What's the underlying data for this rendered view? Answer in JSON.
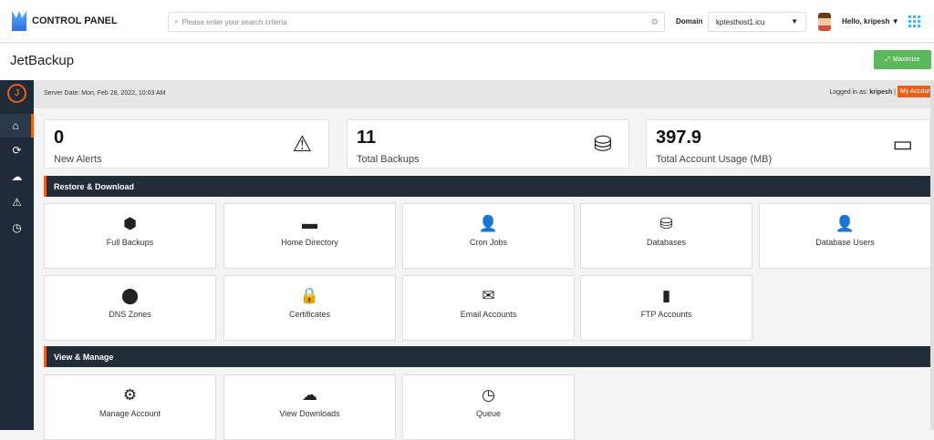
{
  "header": {
    "brand": "CONTROL PANEL",
    "search_placeholder": "Please enter your search criteria",
    "domain_label": "Domain",
    "domain_value": "kptesthost1.icu",
    "greeting": "Hello, kripesh"
  },
  "page": {
    "title": "JetBackup",
    "maximize_label": "Maximize"
  },
  "serverbar": {
    "server_date": "Server Date: Mon, Feb 28, 2022, 10:03 AM",
    "logged_in_prefix": "Logged in as:",
    "user": "kripesh",
    "my_account": "My Account"
  },
  "sidebar": {
    "items": [
      {
        "icon": "home-icon"
      },
      {
        "icon": "refresh-icon"
      },
      {
        "icon": "cloud-download-icon"
      },
      {
        "icon": "warning-icon"
      },
      {
        "icon": "clock-icon"
      }
    ]
  },
  "stats": [
    {
      "value": "0",
      "label": "New Alerts",
      "icon": "warning-icon"
    },
    {
      "value": "11",
      "label": "Total Backups",
      "icon": "database-icon"
    },
    {
      "value": "397.9",
      "label": "Total Account Usage (MB)",
      "icon": "hdd-icon"
    }
  ],
  "sections": [
    {
      "title": "Restore & Download",
      "tiles": [
        {
          "label": "Full Backups",
          "icon": "cubes-icon"
        },
        {
          "label": "Home Directory",
          "icon": "folder-icon"
        },
        {
          "label": "Cron Jobs",
          "icon": "user-clock-icon"
        },
        {
          "label": "Databases",
          "icon": "database-icon"
        },
        {
          "label": "Database Users",
          "icon": "user-tie-icon"
        },
        {
          "label": "DNS Zones",
          "icon": "map-marker-icon"
        },
        {
          "label": "Certificates",
          "icon": "lock-icon"
        },
        {
          "label": "Email Accounts",
          "icon": "envelope-icon"
        },
        {
          "label": "FTP Accounts",
          "icon": "file-icon"
        }
      ]
    },
    {
      "title": "View & Manage",
      "tiles": [
        {
          "label": "Manage Account",
          "icon": "gear-icon"
        },
        {
          "label": "View Downloads",
          "icon": "cloud-download-icon"
        },
        {
          "label": "Queue",
          "icon": "clock-icon"
        }
      ]
    }
  ],
  "colors": {
    "accent": "#e8601c",
    "sidebar": "#1f2b38",
    "section": "#222d3a",
    "maximize": "#5cb85c"
  }
}
